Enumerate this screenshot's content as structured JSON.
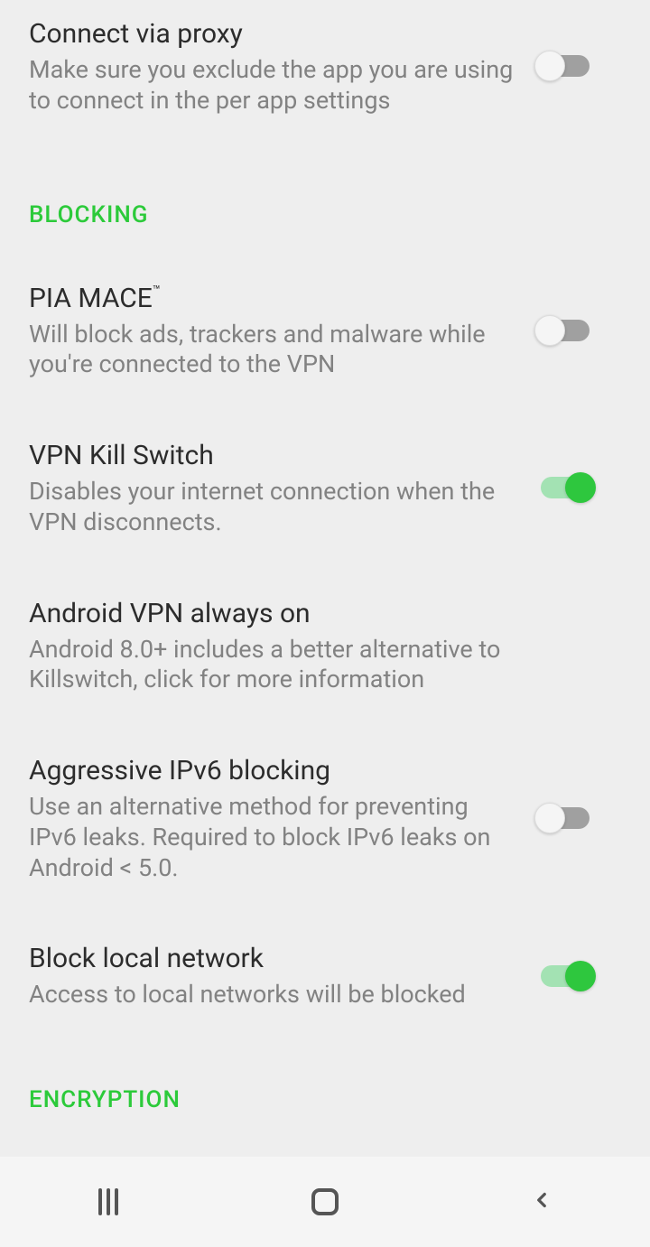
{
  "settings": {
    "connect_via_proxy": {
      "title": "Connect via proxy",
      "desc": "Make sure you exclude the app you are using to connect in the per app settings",
      "on": false
    },
    "section_blocking": "BLOCKING",
    "pia_mace": {
      "title": "PIA MACE",
      "title_tm": "™",
      "desc": "Will block ads, trackers and malware while you're connected to the VPN",
      "on": false
    },
    "kill_switch": {
      "title": "VPN Kill Switch",
      "desc": "Disables your internet connection when the VPN disconnects.",
      "on": true
    },
    "always_on": {
      "title": "Android VPN always on",
      "desc": "Android 8.0+ includes a better alternative to Killswitch, click for more information"
    },
    "ipv6_blocking": {
      "title": "Aggressive IPv6 blocking",
      "desc": "Use an alternative method for preventing IPv6 leaks. Required to block IPv6 leaks on Android < 5.0.",
      "on": false
    },
    "block_local": {
      "title": "Block local network",
      "desc": "Access to local networks will be blocked",
      "on": true
    },
    "section_encryption": "ENCRYPTION"
  }
}
